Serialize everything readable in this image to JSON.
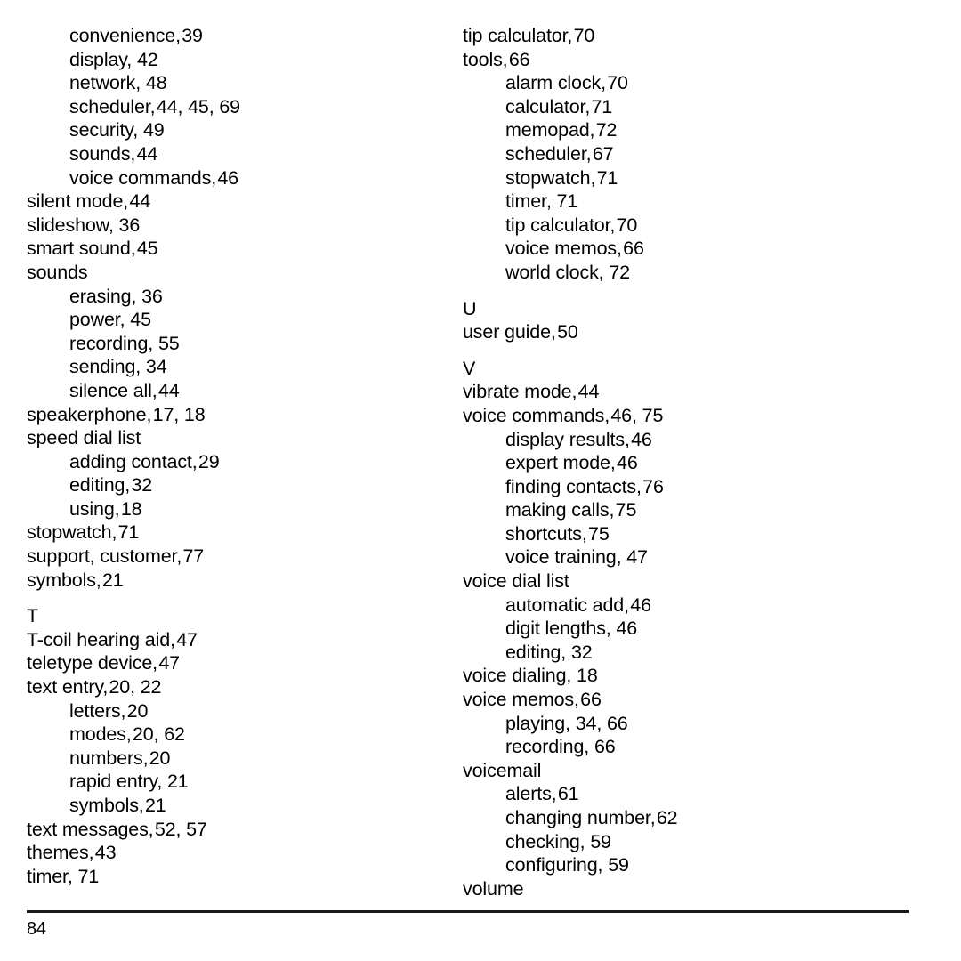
{
  "document": {
    "type": "index",
    "page_number": "84",
    "footer_rule": true
  },
  "columns": [
    {
      "name": "left-column",
      "entries": [
        {
          "level": 1,
          "term": "convenience,",
          "pages": "39",
          "tight": true
        },
        {
          "level": 1,
          "term": "display,",
          "pages": "42",
          "tight": false
        },
        {
          "level": 1,
          "term": "network,",
          "pages": "48",
          "tight": false
        },
        {
          "level": 1,
          "term": "scheduler,",
          "pages": "44, 45, 69",
          "tight": true
        },
        {
          "level": 1,
          "term": "security,",
          "pages": "49",
          "tight": false
        },
        {
          "level": 1,
          "term": "sounds,",
          "pages": "44",
          "tight": true
        },
        {
          "level": 1,
          "term": "voice commands,",
          "pages": "46",
          "tight": true
        },
        {
          "level": 0,
          "term": "silent mode,",
          "pages": "44",
          "tight": true
        },
        {
          "level": 0,
          "term": "slideshow,",
          "pages": "36",
          "tight": false
        },
        {
          "level": 0,
          "term": "smart sound,",
          "pages": "45",
          "tight": true
        },
        {
          "level": 0,
          "term": "sounds",
          "pages": "",
          "tight": false
        },
        {
          "level": 1,
          "term": "erasing,",
          "pages": "36",
          "tight": false
        },
        {
          "level": 1,
          "term": "power,",
          "pages": "45",
          "tight": false
        },
        {
          "level": 1,
          "term": "recording,",
          "pages": "55",
          "tight": false
        },
        {
          "level": 1,
          "term": "sending,",
          "pages": "34",
          "tight": false
        },
        {
          "level": 1,
          "term": "silence all,",
          "pages": "44",
          "tight": true
        },
        {
          "level": 0,
          "term": "speakerphone,",
          "pages": "17, 18",
          "tight": true
        },
        {
          "level": 0,
          "term": "speed dial list",
          "pages": "",
          "tight": false
        },
        {
          "level": 1,
          "term": "adding contact,",
          "pages": "29",
          "tight": true
        },
        {
          "level": 1,
          "term": "editing,",
          "pages": "32",
          "tight": true
        },
        {
          "level": 1,
          "term": "using,",
          "pages": "18",
          "tight": true
        },
        {
          "level": 0,
          "term": "stopwatch,",
          "pages": "71",
          "tight": true
        },
        {
          "level": 0,
          "term": "support, customer,",
          "pages": "77",
          "tight": true
        },
        {
          "level": 0,
          "term": "symbols,",
          "pages": "21",
          "tight": true
        },
        {
          "letter": "T"
        },
        {
          "level": 0,
          "term": "T-coil hearing aid,",
          "pages": "47",
          "tight": true
        },
        {
          "level": 0,
          "term": "teletype device,",
          "pages": "47",
          "tight": true
        },
        {
          "level": 0,
          "term": "text entry,",
          "pages": "20, 22",
          "tight": true
        },
        {
          "level": 1,
          "term": "letters,",
          "pages": "20",
          "tight": true
        },
        {
          "level": 1,
          "term": "modes,",
          "pages": "20, 62",
          "tight": true
        },
        {
          "level": 1,
          "term": "numbers,",
          "pages": "20",
          "tight": true
        },
        {
          "level": 1,
          "term": "rapid entry,",
          "pages": "21",
          "tight": false
        },
        {
          "level": 1,
          "term": "symbols,",
          "pages": "21",
          "tight": true
        },
        {
          "level": 0,
          "term": "text messages,",
          "pages": "52, 57",
          "tight": true
        },
        {
          "level": 0,
          "term": "themes,",
          "pages": "43",
          "tight": true
        },
        {
          "level": 0,
          "term": "timer,",
          "pages": "71",
          "tight": false
        }
      ]
    },
    {
      "name": "right-column",
      "entries": [
        {
          "level": 0,
          "term": "tip calculator,",
          "pages": "70",
          "tight": true
        },
        {
          "level": 0,
          "term": "tools,",
          "pages": "66",
          "tight": true
        },
        {
          "level": 1,
          "term": "alarm clock,",
          "pages": "70",
          "tight": true
        },
        {
          "level": 1,
          "term": "calculator,",
          "pages": "71",
          "tight": true
        },
        {
          "level": 1,
          "term": "memopad,",
          "pages": "72",
          "tight": true
        },
        {
          "level": 1,
          "term": "scheduler,",
          "pages": "67",
          "tight": true
        },
        {
          "level": 1,
          "term": "stopwatch,",
          "pages": "71",
          "tight": true
        },
        {
          "level": 1,
          "term": "timer,",
          "pages": "71",
          "tight": false
        },
        {
          "level": 1,
          "term": "tip calculator,",
          "pages": "70",
          "tight": true
        },
        {
          "level": 1,
          "term": "voice memos,",
          "pages": "66",
          "tight": true
        },
        {
          "level": 1,
          "term": "world clock,",
          "pages": "72",
          "tight": false
        },
        {
          "letter": "U"
        },
        {
          "level": 0,
          "term": "user guide,",
          "pages": "50",
          "tight": true
        },
        {
          "letter": "V"
        },
        {
          "level": 0,
          "term": "vibrate mode,",
          "pages": "44",
          "tight": true
        },
        {
          "level": 0,
          "term": "voice commands,",
          "pages": "46, 75",
          "tight": true
        },
        {
          "level": 1,
          "term": "display results,",
          "pages": "46",
          "tight": true
        },
        {
          "level": 1,
          "term": "expert mode,",
          "pages": "46",
          "tight": true
        },
        {
          "level": 1,
          "term": "finding contacts,",
          "pages": "76",
          "tight": true
        },
        {
          "level": 1,
          "term": "making calls,",
          "pages": "75",
          "tight": true
        },
        {
          "level": 1,
          "term": "shortcuts,",
          "pages": "75",
          "tight": true
        },
        {
          "level": 1,
          "term": "voice training,",
          "pages": "47",
          "tight": false
        },
        {
          "level": 0,
          "term": "voice dial list",
          "pages": "",
          "tight": false
        },
        {
          "level": 1,
          "term": "automatic add,",
          "pages": "46",
          "tight": true
        },
        {
          "level": 1,
          "term": "digit lengths,",
          "pages": "46",
          "tight": false
        },
        {
          "level": 1,
          "term": "editing,",
          "pages": "32",
          "tight": false
        },
        {
          "level": 0,
          "term": "voice dialing,",
          "pages": "18",
          "tight": false
        },
        {
          "level": 0,
          "term": "voice memos,",
          "pages": "66",
          "tight": true
        },
        {
          "level": 1,
          "term": "playing,",
          "pages": "34, 66",
          "tight": false
        },
        {
          "level": 1,
          "term": "recording,",
          "pages": "66",
          "tight": false
        },
        {
          "level": 0,
          "term": "voicemail",
          "pages": "",
          "tight": false
        },
        {
          "level": 1,
          "term": "alerts,",
          "pages": "61",
          "tight": true
        },
        {
          "level": 1,
          "term": "changing number,",
          "pages": "62",
          "tight": true
        },
        {
          "level": 1,
          "term": "checking,",
          "pages": "59",
          "tight": false
        },
        {
          "level": 1,
          "term": "configuring,",
          "pages": "59",
          "tight": false
        },
        {
          "level": 0,
          "term": "volume",
          "pages": "",
          "tight": false
        }
      ]
    }
  ]
}
